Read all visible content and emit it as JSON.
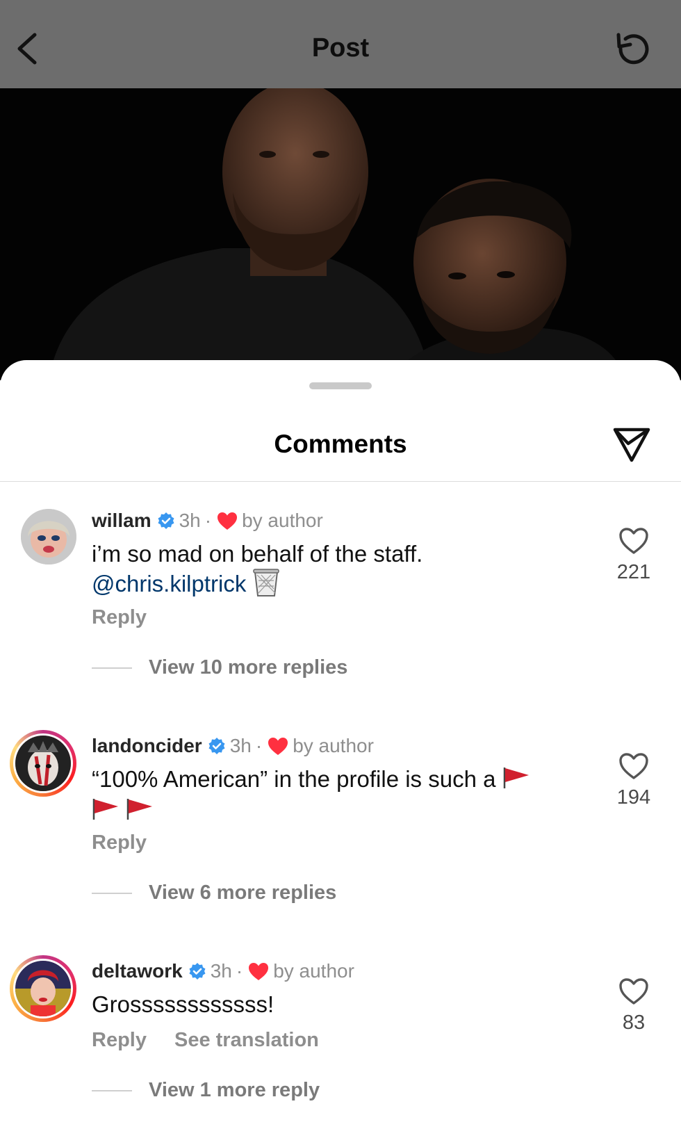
{
  "header": {
    "title": "Post"
  },
  "sheet": {
    "title": "Comments"
  },
  "comments": [
    {
      "username": "willam",
      "time": "3h",
      "separator": "·",
      "liked_by": "by author",
      "text": "i’m so mad on behalf of the staff.",
      "mention": "@chris.kilptrick",
      "emoji": "wastebasket",
      "reply_label": "Reply",
      "likes": "221",
      "view_more": "View 10 more replies"
    },
    {
      "username": "landoncider",
      "time": "3h",
      "separator": "·",
      "liked_by": "by author",
      "text": "“100% American” in the profile is such a",
      "emoji": "triangular-flag",
      "reply_label": "Reply",
      "likes": "194",
      "view_more": "View 6 more replies"
    },
    {
      "username": "deltawork",
      "time": "3h",
      "separator": "·",
      "liked_by": "by author",
      "text": "Grossssssssssss!",
      "reply_label": "Reply",
      "translate_label": "See translation",
      "likes": "83",
      "view_more": "View 1 more reply"
    }
  ],
  "colors": {
    "topbar": "#6d6d6d",
    "verified": "#3897f0",
    "heart": "#ff3040",
    "mention": "#00376b",
    "meta": "#8e8e8e"
  }
}
